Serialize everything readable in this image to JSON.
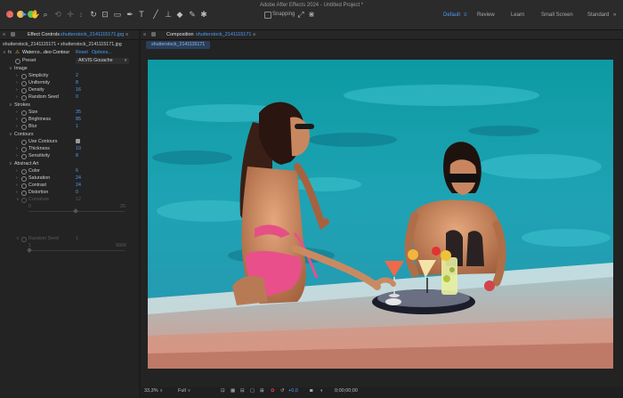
{
  "app": {
    "title": "Adobe After Effects 2024 - Untitled Project *"
  },
  "toolbar": {
    "snapping_label": "Snapping"
  },
  "workspaces": [
    "Default",
    "Review",
    "Learn",
    "Small Screen",
    "Standard"
  ],
  "effect_controls": {
    "tab_label": "Effect Controls",
    "tab_file": "shutterstock_2141115171.jpg",
    "layer_path": "shutterstock_2141115171 • shutterstock_2141115171.jpg",
    "effect_name": "Waterco...deo Contour",
    "reset_label": "Reset",
    "options_label": "Options...",
    "preset_label": "Preset",
    "preset_value": "AKVIS Gouache",
    "sections": {
      "image": "Image",
      "strokes": "Strokes",
      "contours": "Contours",
      "abstract": "Abstract Art"
    },
    "params": {
      "simplicity": {
        "label": "Simplicity",
        "value": "2"
      },
      "uniformity": {
        "label": "Uniformity",
        "value": "8"
      },
      "density": {
        "label": "Density",
        "value": "16"
      },
      "random_seed": {
        "label": "Random Seed",
        "value": "0"
      },
      "size": {
        "label": "Size",
        "value": "35"
      },
      "brightness": {
        "label": "Brightness",
        "value": "85"
      },
      "blur": {
        "label": "Blur",
        "value": "1"
      },
      "use_contours": {
        "label": "Use Contours"
      },
      "thickness": {
        "label": "Thickness",
        "value": "10"
      },
      "sensitivity": {
        "label": "Sensitivity",
        "value": "8"
      },
      "color": {
        "label": "Color",
        "value": "6"
      },
      "saturation": {
        "label": "Saturation",
        "value": "24"
      },
      "contrast": {
        "label": "Contrast",
        "value": "24"
      },
      "distortion": {
        "label": "Distortion",
        "value": "0"
      },
      "curvature": {
        "label": "Curvature",
        "value": "12",
        "min": "0",
        "max": "25"
      },
      "random_seed2": {
        "label": "Random Seed",
        "value": "1",
        "min": "1",
        "max": "9999"
      }
    }
  },
  "composition": {
    "tab_label": "Composition",
    "tab_name": "shutterstock_2141115171",
    "sub_tab": "shutterstock_2141115171"
  },
  "viewer_bar": {
    "zoom": "33,3%",
    "resolution": "Full",
    "exposure": "+0,0",
    "timecode": "0;00;00;00"
  }
}
